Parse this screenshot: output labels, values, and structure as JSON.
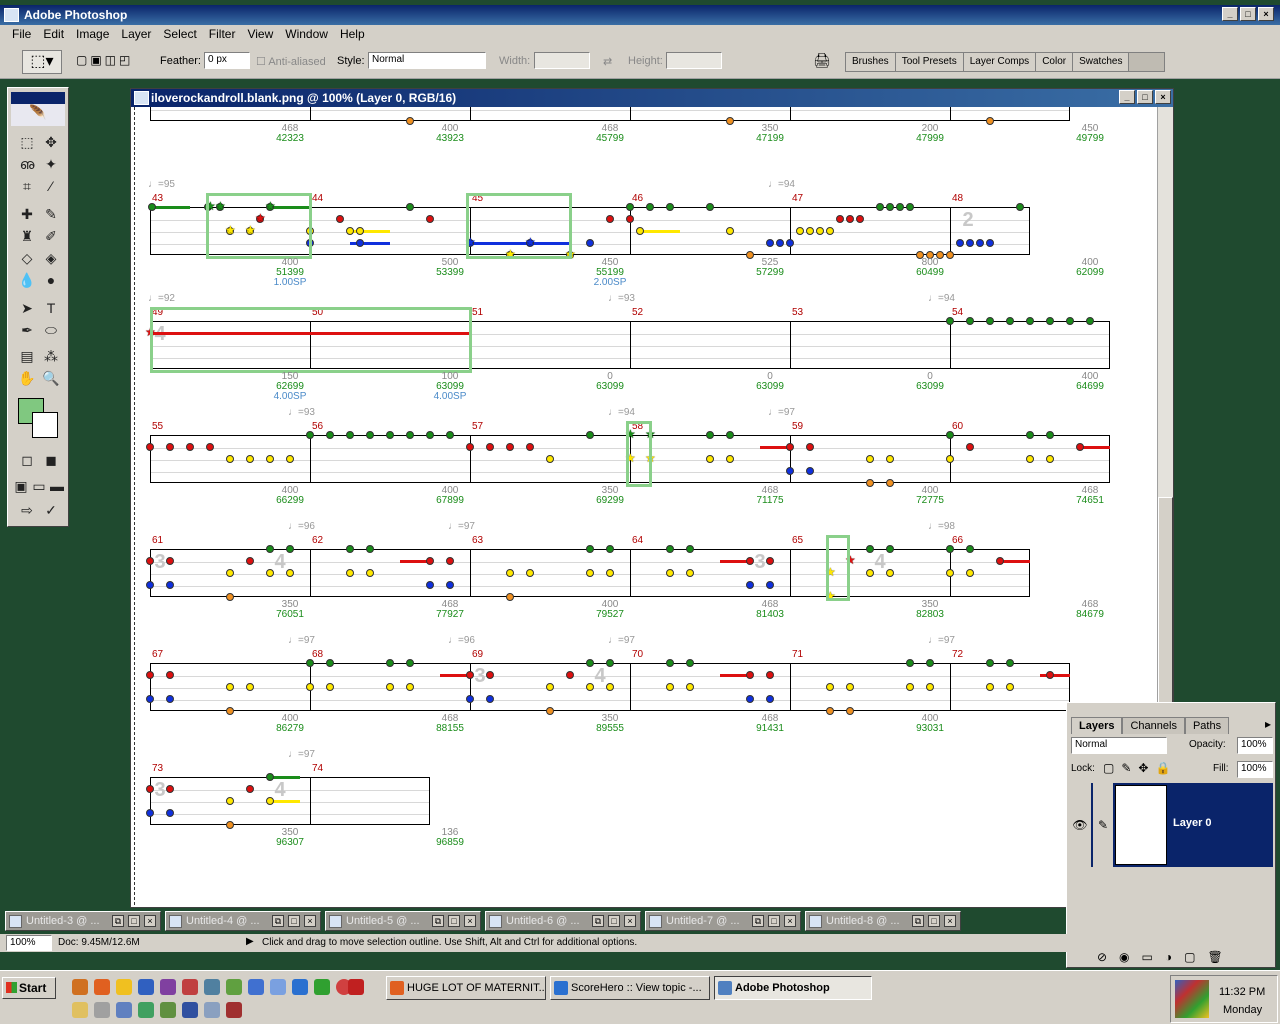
{
  "app": {
    "title": "Adobe Photoshop",
    "menu": [
      "File",
      "Edit",
      "Image",
      "Layer",
      "Select",
      "Filter",
      "View",
      "Window",
      "Help"
    ]
  },
  "options": {
    "feather_label": "Feather:",
    "feather_value": "0 px",
    "antialias_label": "Anti-aliased",
    "style_label": "Style:",
    "style_value": "Normal",
    "width_label": "Width:",
    "height_label": "Height:"
  },
  "palette_well": [
    "Brushes",
    "Tool Presets",
    "Layer Comps",
    "Color",
    "Swatches"
  ],
  "document": {
    "title": "iloverockandroll.blank.png @ 100% (Layer 0, RGB/16)"
  },
  "colors": {
    "foreground": "#80c880",
    "background": "#ffffff",
    "green": "#1a8c1a",
    "red": "#dd1010",
    "yellow": "#ffe800",
    "blue": "#1030dd",
    "orange": "#f09020",
    "sp_box": "#8ad08a"
  },
  "chart_rows": [
    {
      "top_partial": true,
      "labels": [
        {
          "t": "468",
          "v": "42323"
        },
        {
          "t": "400",
          "v": "43923"
        },
        {
          "t": "468",
          "v": "45799"
        },
        {
          "t": "350",
          "v": "47199"
        },
        {
          "t": "200",
          "v": "47999"
        },
        {
          "t": "450",
          "v": "49799"
        }
      ]
    }
  ],
  "measures": [
    {
      "row": 1,
      "items": [
        {
          "m": "43",
          "tempo": "=95"
        },
        {
          "m": "44"
        },
        {
          "m": "45"
        },
        {
          "m": "46"
        },
        {
          "m": "47",
          "tempo": "=94"
        },
        {
          "m": "48"
        }
      ],
      "bottom": [
        {
          "t": "400",
          "v": "51399",
          "sp": "1.00SP"
        },
        {
          "t": "500",
          "v": "53399"
        },
        {
          "t": "450",
          "v": "55199",
          "sp": "2.00SP"
        },
        {
          "t": "525",
          "v": "57299"
        },
        {
          "t": "800",
          "v": "60499"
        },
        {
          "t": "400",
          "v": "62099"
        }
      ]
    },
    {
      "row": 2,
      "items": [
        {
          "m": "49",
          "tempo": "=92"
        },
        {
          "m": "50"
        },
        {
          "m": "51"
        },
        {
          "m": "52",
          "tempo": "=93"
        },
        {
          "m": "53"
        },
        {
          "m": "54",
          "tempo": "=94"
        }
      ],
      "bottom": [
        {
          "t": "150",
          "v": "62699",
          "sp": "4.00SP"
        },
        {
          "t": "100",
          "v": "63099",
          "sp": "4.00SP"
        },
        {
          "t": "0",
          "v": "63099"
        },
        {
          "t": "0",
          "v": "63099"
        },
        {
          "t": "0",
          "v": "63099"
        },
        {
          "t": "400",
          "v": "64699"
        }
      ]
    },
    {
      "row": 3,
      "items": [
        {
          "m": "55"
        },
        {
          "m": "56",
          "tempo": "=93"
        },
        {
          "m": "57"
        },
        {
          "m": "58",
          "tempo": "=94"
        },
        {
          "m": "59",
          "tempo": "=97"
        },
        {
          "m": "60"
        }
      ],
      "bottom": [
        {
          "t": "400",
          "v": "66299"
        },
        {
          "t": "400",
          "v": "67899"
        },
        {
          "t": "350",
          "v": "69299"
        },
        {
          "t": "468",
          "v": "71175"
        },
        {
          "t": "400",
          "v": "72775"
        },
        {
          "t": "468",
          "v": "74651"
        }
      ]
    },
    {
      "row": 4,
      "items": [
        {
          "m": "61"
        },
        {
          "m": "62",
          "tempo": "=96"
        },
        {
          "m": "63",
          "tempo": "=97"
        },
        {
          "m": "64"
        },
        {
          "m": "65"
        },
        {
          "m": "66",
          "tempo": "=98"
        }
      ],
      "bottom": [
        {
          "t": "350",
          "v": "76051"
        },
        {
          "t": "468",
          "v": "77927"
        },
        {
          "t": "400",
          "v": "79527"
        },
        {
          "t": "468",
          "v": "81403"
        },
        {
          "t": "350",
          "v": "82803"
        },
        {
          "t": "468",
          "v": "84679"
        }
      ]
    },
    {
      "row": 5,
      "items": [
        {
          "m": "67"
        },
        {
          "m": "68",
          "tempo": "=97"
        },
        {
          "m": "69",
          "tempo": "=96"
        },
        {
          "m": "70",
          "tempo": "=97"
        },
        {
          "m": "71"
        },
        {
          "m": "72",
          "tempo": "=97"
        }
      ],
      "bottom": [
        {
          "t": "400",
          "v": "86279"
        },
        {
          "t": "468",
          "v": "88155"
        },
        {
          "t": "350",
          "v": "89555"
        },
        {
          "t": "468",
          "v": "91431"
        },
        {
          "t": "400",
          "v": "93031"
        },
        {
          "t": "468",
          "v": "94907"
        }
      ]
    },
    {
      "row": 6,
      "items": [
        {
          "m": "73"
        },
        {
          "m": "74",
          "tempo": "=97"
        }
      ],
      "bottom": [
        {
          "t": "350",
          "v": "96307"
        },
        {
          "t": "136",
          "v": "96859"
        }
      ]
    }
  ],
  "layers_panel": {
    "tabs": [
      "Layers",
      "Channels",
      "Paths"
    ],
    "blend": "Normal",
    "opacity_label": "Opacity:",
    "opacity": "100%",
    "lock_label": "Lock:",
    "fill_label": "Fill:",
    "fill": "100%",
    "layer_name": "Layer 0"
  },
  "doc_tabs": [
    "Untitled-3 @ ...",
    "Untitled-4 @ ...",
    "Untitled-5 @ ...",
    "Untitled-6 @ ...",
    "Untitled-7 @ ...",
    "Untitled-8 @ ..."
  ],
  "status": {
    "zoom": "100%",
    "doc": "Doc: 9.45M/12.6M",
    "hint": "Click and drag to move selection outline.  Use Shift, Alt and Ctrl for additional options."
  },
  "taskbar": {
    "start": "Start",
    "tasks": [
      "HUGE LOT OF MATERNIT...",
      "ScoreHero :: View topic -...",
      "Adobe Photoshop"
    ],
    "time": "11:32 PM",
    "day": "Monday"
  }
}
